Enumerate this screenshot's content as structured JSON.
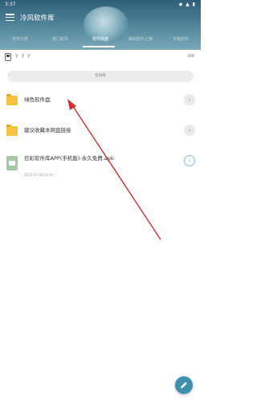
{
  "status": {
    "time": "3:37",
    "icons": "◆ ▲ ▮"
  },
  "appbar": {
    "title": "冷风软件库"
  },
  "tabs": [
    {
      "label": "软件分类"
    },
    {
      "label": "热门软件"
    },
    {
      "label": "软件网盘"
    },
    {
      "label": "最新软件上架"
    },
    {
      "label": "专题软件"
    }
  ],
  "profile": {
    "username": "? ? ?",
    "detail_link": "详情"
  },
  "login_button": "登录库",
  "items": [
    {
      "label": "绿色软件盘"
    },
    {
      "label": "建议收藏本网盘链接"
    },
    {
      "label": "信彩软件库APP(手机版)-永久免费.apk",
      "date": "2023-07-26  14:54"
    }
  ],
  "colors": {
    "header": "#4c8096",
    "folder": "#f6c343",
    "arrow": "#d32f2f",
    "fab": "#3f8fb0"
  },
  "icons": {
    "menu": "menu-icon",
    "folder": "folder-icon",
    "file": "apk-file-icon",
    "more": "chevron-right-icon",
    "download": "download-icon",
    "fab": "edit-icon"
  }
}
